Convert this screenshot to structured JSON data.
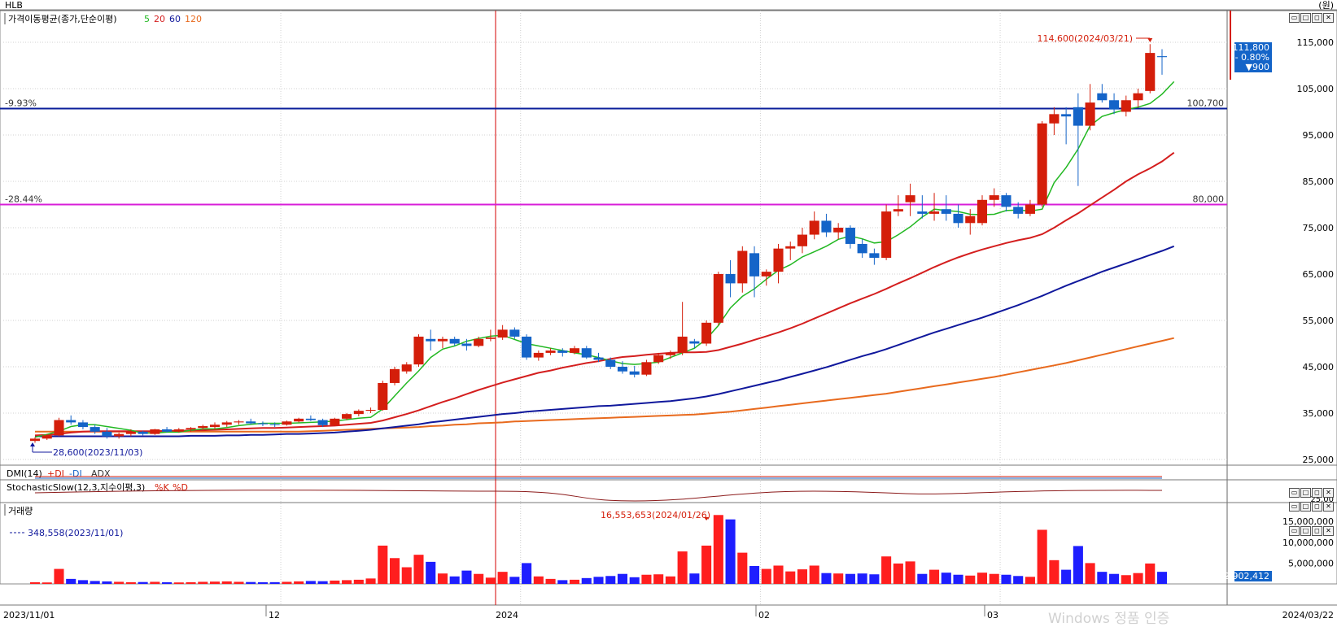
{
  "window": {
    "title": "HLB",
    "unit_label": "(원)"
  },
  "colors": {
    "up": "#d41e0a",
    "down": "#1464c8",
    "ma5": "#22b822",
    "ma20": "#d41e1e",
    "ma60": "#10189c",
    "ma120": "#e86a1e",
    "line_blue": "#0a1e9a",
    "line_magenta": "#d81ed8",
    "crosshair": "#d40000",
    "grid": "#d0d0d0"
  },
  "price_panel": {
    "legend_title": "가격이동평균(종가,단순이평)",
    "legend_periods": [
      "5",
      "20",
      "60",
      "120"
    ],
    "y_ticks": [
      "115,000",
      "105,000",
      "95,000",
      "85,000",
      "75,000",
      "65,000",
      "55,000",
      "45,000",
      "35,000",
      "25,000"
    ],
    "high_annotation": "114,600(2024/03/21)",
    "low_annotation": "28,600(2023/11/03)",
    "hline_upper": {
      "left_label": "-9.93%",
      "right_label": "100,700",
      "value": 100700
    },
    "hline_lower": {
      "left_label": "-28.44%",
      "right_label": "80,000",
      "value": 80000
    },
    "current_price": {
      "price": "111,800",
      "pct": "- 0.80%",
      "change": "▼900"
    }
  },
  "dmi_panel": {
    "title": "DMI(14)",
    "items": [
      "+DI",
      "-DI",
      "ADX"
    ]
  },
  "stoch_panel": {
    "title": "StochasticSlow(12,3,지수이평,3)",
    "items": [
      "%K",
      "%D"
    ],
    "right_label": "25.00"
  },
  "volume_panel": {
    "title": "거래량",
    "max_annotation": "16,553,653(2024/01/26)",
    "min_annotation": "348,558(2023/11/01)",
    "y_ticks": [
      "15,000,000",
      "10,000,000",
      "5,000,000"
    ],
    "current_volume": "2,902,412"
  },
  "x_axis": {
    "start_date": "2023/11/01",
    "end_date": "2024/03/22",
    "month_labels": [
      "12",
      "2024",
      "02",
      "03"
    ]
  },
  "chart_data": {
    "type": "candlestick",
    "price_ylim": [
      25000,
      115000
    ],
    "volume_ylim": [
      0,
      17000000
    ],
    "candles": [
      {
        "o": 29000,
        "h": 29800,
        "l": 28600,
        "c": 29500,
        "v": 400000
      },
      {
        "o": 29500,
        "h": 30500,
        "l": 29200,
        "c": 30200,
        "v": 348558
      },
      {
        "o": 30200,
        "h": 34000,
        "l": 30000,
        "c": 33500,
        "v": 3600000
      },
      {
        "o": 33500,
        "h": 34500,
        "l": 32500,
        "c": 33000,
        "v": 1200000
      },
      {
        "o": 33000,
        "h": 33500,
        "l": 31500,
        "c": 32000,
        "v": 900000
      },
      {
        "o": 32000,
        "h": 32500,
        "l": 30500,
        "c": 31000,
        "v": 700000
      },
      {
        "o": 31000,
        "h": 31800,
        "l": 29500,
        "c": 30000,
        "v": 600000
      },
      {
        "o": 30000,
        "h": 30800,
        "l": 29500,
        "c": 30500,
        "v": 500000
      },
      {
        "o": 30500,
        "h": 31500,
        "l": 30000,
        "c": 31000,
        "v": 400000
      },
      {
        "o": 31000,
        "h": 31200,
        "l": 30200,
        "c": 30500,
        "v": 450000
      },
      {
        "o": 30500,
        "h": 31600,
        "l": 30300,
        "c": 31500,
        "v": 500000
      },
      {
        "o": 31500,
        "h": 32000,
        "l": 30800,
        "c": 31000,
        "v": 400000
      },
      {
        "o": 31000,
        "h": 31800,
        "l": 30800,
        "c": 31500,
        "v": 350000
      },
      {
        "o": 31500,
        "h": 32000,
        "l": 31000,
        "c": 31800,
        "v": 400000
      },
      {
        "o": 31800,
        "h": 32500,
        "l": 31500,
        "c": 32200,
        "v": 500000
      },
      {
        "o": 32000,
        "h": 33000,
        "l": 31500,
        "c": 32500,
        "v": 550000
      },
      {
        "o": 32500,
        "h": 33300,
        "l": 32000,
        "c": 33000,
        "v": 600000
      },
      {
        "o": 33000,
        "h": 33500,
        "l": 32500,
        "c": 33200,
        "v": 500000
      },
      {
        "o": 33200,
        "h": 33800,
        "l": 32600,
        "c": 32800,
        "v": 450000
      },
      {
        "o": 32800,
        "h": 33200,
        "l": 32200,
        "c": 32600,
        "v": 400000
      },
      {
        "o": 32600,
        "h": 33000,
        "l": 32000,
        "c": 32500,
        "v": 420000
      },
      {
        "o": 32500,
        "h": 33400,
        "l": 32300,
        "c": 33200,
        "v": 500000
      },
      {
        "o": 33200,
        "h": 34000,
        "l": 33000,
        "c": 33800,
        "v": 600000
      },
      {
        "o": 33800,
        "h": 34500,
        "l": 33300,
        "c": 33500,
        "v": 700000
      },
      {
        "o": 33500,
        "h": 33800,
        "l": 32000,
        "c": 32400,
        "v": 650000
      },
      {
        "o": 32400,
        "h": 34000,
        "l": 32200,
        "c": 33800,
        "v": 800000
      },
      {
        "o": 33800,
        "h": 35000,
        "l": 33500,
        "c": 34800,
        "v": 900000
      },
      {
        "o": 34800,
        "h": 35800,
        "l": 34300,
        "c": 35500,
        "v": 1000000
      },
      {
        "o": 35500,
        "h": 36200,
        "l": 35000,
        "c": 35700,
        "v": 1300000
      },
      {
        "o": 35700,
        "h": 42000,
        "l": 35500,
        "c": 41500,
        "v": 9200000
      },
      {
        "o": 41500,
        "h": 45000,
        "l": 41000,
        "c": 44500,
        "v": 6200000
      },
      {
        "o": 44000,
        "h": 46000,
        "l": 43500,
        "c": 45500,
        "v": 4000000
      },
      {
        "o": 45500,
        "h": 52000,
        "l": 45000,
        "c": 51500,
        "v": 7000000
      },
      {
        "o": 51000,
        "h": 53000,
        "l": 48500,
        "c": 50500,
        "v": 5300000
      },
      {
        "o": 50500,
        "h": 51500,
        "l": 49000,
        "c": 51000,
        "v": 2500000
      },
      {
        "o": 51000,
        "h": 51500,
        "l": 49500,
        "c": 50000,
        "v": 1800000
      },
      {
        "o": 50000,
        "h": 51000,
        "l": 48500,
        "c": 49500,
        "v": 3200000
      },
      {
        "o": 49500,
        "h": 51500,
        "l": 49200,
        "c": 51000,
        "v": 2400000
      },
      {
        "o": 51000,
        "h": 53000,
        "l": 50500,
        "c": 51300,
        "v": 1500000
      },
      {
        "o": 51300,
        "h": 54000,
        "l": 50800,
        "c": 53000,
        "v": 2900000
      },
      {
        "o": 53000,
        "h": 53500,
        "l": 51000,
        "c": 51500,
        "v": 1700000
      },
      {
        "o": 51500,
        "h": 52000,
        "l": 46500,
        "c": 47000,
        "v": 5000000
      },
      {
        "o": 47000,
        "h": 48500,
        "l": 46300,
        "c": 48000,
        "v": 1800000
      },
      {
        "o": 48000,
        "h": 49000,
        "l": 47500,
        "c": 48500,
        "v": 1200000
      },
      {
        "o": 48500,
        "h": 49000,
        "l": 47200,
        "c": 48000,
        "v": 900000
      },
      {
        "o": 48000,
        "h": 49500,
        "l": 47700,
        "c": 49000,
        "v": 1000000
      },
      {
        "o": 49000,
        "h": 49500,
        "l": 46700,
        "c": 47000,
        "v": 1400000
      },
      {
        "o": 47000,
        "h": 48000,
        "l": 46000,
        "c": 46500,
        "v": 1700000
      },
      {
        "o": 46500,
        "h": 47000,
        "l": 44500,
        "c": 45000,
        "v": 1900000
      },
      {
        "o": 45000,
        "h": 46200,
        "l": 43500,
        "c": 44000,
        "v": 2400000
      },
      {
        "o": 44000,
        "h": 45200,
        "l": 42700,
        "c": 43300,
        "v": 1600000
      },
      {
        "o": 43300,
        "h": 46500,
        "l": 43000,
        "c": 46000,
        "v": 2200000
      },
      {
        "o": 46000,
        "h": 48000,
        "l": 45600,
        "c": 47500,
        "v": 2300000
      },
      {
        "o": 47500,
        "h": 48500,
        "l": 46700,
        "c": 48000,
        "v": 1800000
      },
      {
        "o": 48000,
        "h": 59000,
        "l": 47500,
        "c": 51500,
        "v": 7800000
      },
      {
        "o": 50500,
        "h": 51000,
        "l": 49000,
        "c": 50000,
        "v": 2500000
      },
      {
        "o": 50000,
        "h": 55000,
        "l": 49500,
        "c": 54500,
        "v": 9200000
      },
      {
        "o": 54500,
        "h": 65500,
        "l": 54000,
        "c": 65000,
        "v": 16553653
      },
      {
        "o": 65000,
        "h": 68000,
        "l": 60000,
        "c": 63000,
        "v": 15500000
      },
      {
        "o": 63000,
        "h": 71000,
        "l": 61000,
        "c": 70000,
        "v": 7500000
      },
      {
        "o": 69500,
        "h": 71000,
        "l": 60000,
        "c": 64500,
        "v": 4300000
      },
      {
        "o": 64500,
        "h": 66000,
        "l": 62500,
        "c": 65500,
        "v": 3600000
      },
      {
        "o": 65500,
        "h": 71500,
        "l": 63000,
        "c": 70500,
        "v": 4400000
      },
      {
        "o": 70500,
        "h": 72000,
        "l": 68000,
        "c": 71000,
        "v": 3000000
      },
      {
        "o": 71000,
        "h": 75000,
        "l": 69500,
        "c": 73500,
        "v": 3500000
      },
      {
        "o": 73500,
        "h": 78500,
        "l": 72500,
        "c": 76500,
        "v": 4400000
      },
      {
        "o": 76500,
        "h": 78000,
        "l": 73000,
        "c": 74000,
        "v": 2600000
      },
      {
        "o": 74000,
        "h": 76000,
        "l": 72500,
        "c": 75000,
        "v": 2500000
      },
      {
        "o": 75000,
        "h": 75500,
        "l": 70500,
        "c": 71500,
        "v": 2400000
      },
      {
        "o": 71500,
        "h": 72500,
        "l": 68500,
        "c": 69500,
        "v": 2500000
      },
      {
        "o": 69500,
        "h": 70500,
        "l": 67000,
        "c": 68500,
        "v": 2300000
      },
      {
        "o": 68500,
        "h": 80000,
        "l": 68000,
        "c": 78500,
        "v": 6600000
      },
      {
        "o": 78500,
        "h": 82000,
        "l": 77500,
        "c": 79000,
        "v": 4900000
      },
      {
        "o": 80500,
        "h": 84500,
        "l": 77500,
        "c": 82000,
        "v": 5400000
      },
      {
        "o": 78500,
        "h": 82000,
        "l": 77000,
        "c": 78000,
        "v": 2400000
      },
      {
        "o": 78000,
        "h": 82500,
        "l": 76500,
        "c": 78500,
        "v": 3400000
      },
      {
        "o": 79000,
        "h": 82000,
        "l": 76500,
        "c": 78000,
        "v": 2700000
      },
      {
        "o": 78000,
        "h": 80000,
        "l": 75000,
        "c": 76000,
        "v": 2200000
      },
      {
        "o": 76000,
        "h": 79000,
        "l": 73500,
        "c": 77500,
        "v": 2000000
      },
      {
        "o": 76000,
        "h": 82000,
        "l": 75500,
        "c": 81000,
        "v": 2700000
      },
      {
        "o": 81000,
        "h": 83500,
        "l": 79500,
        "c": 82000,
        "v": 2400000
      },
      {
        "o": 82000,
        "h": 82500,
        "l": 78500,
        "c": 79500,
        "v": 2200000
      },
      {
        "o": 79500,
        "h": 80500,
        "l": 77000,
        "c": 78000,
        "v": 1900000
      },
      {
        "o": 78000,
        "h": 81000,
        "l": 77500,
        "c": 80000,
        "v": 1700000
      },
      {
        "o": 80000,
        "h": 98000,
        "l": 79500,
        "c": 97500,
        "v": 13000000
      },
      {
        "o": 97500,
        "h": 101000,
        "l": 95000,
        "c": 99500,
        "v": 5700000
      },
      {
        "o": 99500,
        "h": 101000,
        "l": 93000,
        "c": 99000,
        "v": 3400000
      },
      {
        "o": 101000,
        "h": 104000,
        "l": 84000,
        "c": 97000,
        "v": 9100000
      },
      {
        "o": 97000,
        "h": 106000,
        "l": 96000,
        "c": 102000,
        "v": 5000000
      },
      {
        "o": 104000,
        "h": 106000,
        "l": 102000,
        "c": 102500,
        "v": 2900000
      },
      {
        "o": 102500,
        "h": 104000,
        "l": 99500,
        "c": 100500,
        "v": 2400000
      },
      {
        "o": 100000,
        "h": 103500,
        "l": 99000,
        "c": 102500,
        "v": 2100000
      },
      {
        "o": 102500,
        "h": 105000,
        "l": 101000,
        "c": 104000,
        "v": 2600000
      },
      {
        "o": 104500,
        "h": 114600,
        "l": 104000,
        "c": 112700,
        "v": 4900000
      },
      {
        "o": 112000,
        "h": 113500,
        "l": 108000,
        "c": 111800,
        "v": 2902412
      }
    ],
    "ma5": [
      29800,
      30400,
      31100,
      32100,
      32500,
      32500,
      32100,
      31700,
      31300,
      30700,
      30700,
      30900,
      30900,
      31300,
      31600,
      31600,
      31900,
      32300,
      32600,
      32800,
      32800,
      32800,
      32900,
      33000,
      33100,
      33300,
      33600,
      33900,
      34100,
      35900,
      38700,
      41500,
      44100,
      47000,
      48800,
      49500,
      50500,
      51100,
      51600,
      51800,
      50900,
      50000,
      49500,
      49000,
      48500,
      48000,
      47600,
      47000,
      46300,
      45700,
      45500,
      45700,
      46000,
      47000,
      48000,
      49000,
      51000,
      53900,
      57700,
      60200,
      61800,
      63900,
      65800,
      67000,
      68700,
      69800,
      71000,
      72500,
      73200,
      72600,
      71700,
      72000,
      73500,
      75200,
      77300,
      79000,
      78700,
      78500,
      77900,
      77800,
      77900,
      78700,
      78800,
      78600,
      79000,
      84700,
      88000,
      92000,
      97000,
      99000,
      99800,
      100500,
      101000,
      101800,
      103800,
      106500
    ],
    "ma20": [
      30200,
      30300,
      30500,
      30800,
      31000,
      31100,
      31100,
      31100,
      31100,
      31100,
      31100,
      31200,
      31200,
      31300,
      31300,
      31400,
      31500,
      31600,
      31700,
      31800,
      31800,
      31900,
      32000,
      32100,
      32200,
      32300,
      32500,
      32700,
      32900,
      33400,
      34100,
      34800,
      35600,
      36500,
      37400,
      38200,
      39100,
      40000,
      40800,
      41600,
      42300,
      43000,
      43700,
      44200,
      44800,
      45300,
      45800,
      46200,
      46700,
      47100,
      47300,
      47600,
      47800,
      48000,
      48100,
      48100,
      48200,
      48600,
      49300,
      50000,
      50800,
      51600,
      52400,
      53300,
      54300,
      55400,
      56500,
      57600,
      58700,
      59700,
      60700,
      61800,
      63000,
      64100,
      65300,
      66500,
      67600,
      68600,
      69500,
      70300,
      71000,
      71700,
      72300,
      72800,
      73600,
      75000,
      76600,
      78100,
      79800,
      81500,
      83200,
      85000,
      86500,
      87800,
      89300,
      91200
    ],
    "ma60": [
      30000,
      30000,
      30000,
      30000,
      30000,
      30000,
      30000,
      30000,
      30000,
      30000,
      30000,
      30000,
      30000,
      30100,
      30100,
      30100,
      30200,
      30200,
      30300,
      30300,
      30400,
      30500,
      30500,
      30600,
      30700,
      30800,
      31000,
      31200,
      31400,
      31700,
      32000,
      32300,
      32600,
      33000,
      33300,
      33600,
      33900,
      34200,
      34500,
      34800,
      35000,
      35300,
      35500,
      35700,
      35900,
      36100,
      36300,
      36500,
      36600,
      36800,
      37000,
      37200,
      37400,
      37600,
      37900,
      38200,
      38600,
      39100,
      39700,
      40300,
      40900,
      41500,
      42100,
      42800,
      43500,
      44200,
      44900,
      45700,
      46500,
      47300,
      48000,
      48800,
      49700,
      50600,
      51500,
      52400,
      53200,
      54000,
      54800,
      55600,
      56500,
      57400,
      58300,
      59300,
      60300,
      61400,
      62500,
      63500,
      64500,
      65500,
      66400,
      67300,
      68200,
      69100,
      70000,
      71000
    ],
    "ma120": [
      31000,
      31000,
      31000,
      31000,
      31000,
      31000,
      31000,
      31000,
      31000,
      31000,
      31000,
      31000,
      31000,
      31000,
      31000,
      31000,
      31000,
      31000,
      31000,
      31000,
      31000,
      31000,
      31000,
      31100,
      31200,
      31300,
      31400,
      31500,
      31600,
      31700,
      31800,
      31900,
      32000,
      32200,
      32300,
      32500,
      32600,
      32800,
      32900,
      33000,
      33200,
      33300,
      33400,
      33500,
      33600,
      33700,
      33800,
      33900,
      34000,
      34100,
      34200,
      34300,
      34400,
      34500,
      34600,
      34700,
      34900,
      35100,
      35300,
      35600,
      35900,
      36200,
      36500,
      36800,
      37100,
      37400,
      37700,
      38000,
      38300,
      38600,
      38900,
      39200,
      39600,
      40000,
      40400,
      40800,
      41200,
      41600,
      42000,
      42400,
      42800,
      43300,
      43800,
      44300,
      44800,
      45300,
      45800,
      46400,
      47000,
      47600,
      48200,
      48800,
      49400,
      50000,
      50600,
      51200
    ]
  }
}
